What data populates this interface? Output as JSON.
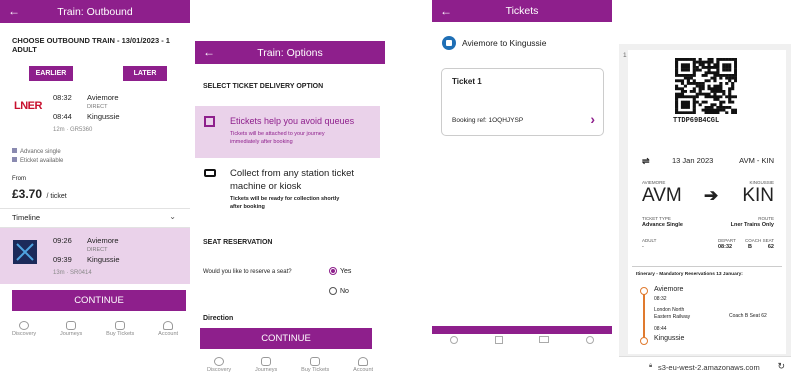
{
  "colors": {
    "brand": "#8e1f8c",
    "highlight": "#ead2ea",
    "lner": "#c8102e",
    "orange": "#e07a2e"
  },
  "outbound": {
    "header_title": "Train: Outbound",
    "heading_line1": "CHOOSE OUTBOUND TRAIN - 13/01/2023 - 1",
    "heading_line2": "ADULT",
    "earlier": "EARLIER",
    "later": "LATER",
    "operator": "LNER",
    "train1": {
      "dep_time": "08:32",
      "dep_station": "Aviemore",
      "type": "DIRECT",
      "arr_time": "08:44",
      "arr_station": "Kingussie",
      "meta": "12m · GR5360"
    },
    "ticket_type": "Advance single",
    "eticket": "Eticket available",
    "from_label": "From",
    "price": "£3.70",
    "price_unit": "/ ticket",
    "timeline": "Timeline",
    "train2": {
      "dep_time": "09:26",
      "dep_station": "Aviemore",
      "type": "DIRECT",
      "arr_time": "09:39",
      "arr_station": "Kingussie",
      "meta": "13m · SR0414"
    },
    "continue": "CONTINUE",
    "nav": [
      "Discovery",
      "Journeys",
      "Buy Tickets",
      "Account"
    ]
  },
  "options": {
    "header_title": "Train: Options",
    "delivery_heading": "SELECT TICKET DELIVERY OPTION",
    "opt1_title": "Etickets help you avoid queues",
    "opt1_desc_1": "Tickets will be attached to your journey",
    "opt1_desc_2": "immediately after booking",
    "opt2_title_1": "Collect from any station ticket",
    "opt2_title_2": "machine or kiosk",
    "opt2_desc_1": "Tickets will be ready for collection shortly",
    "opt2_desc_2": "after booking",
    "seat_heading": "SEAT RESERVATION",
    "seat_question": "Would you like to reserve a seat?",
    "yes": "Yes",
    "no": "No",
    "direction": "Direction",
    "continue": "CONTINUE",
    "nav": [
      "Discovery",
      "Journeys",
      "Buy Tickets",
      "Account"
    ]
  },
  "tickets": {
    "header_title": "Tickets",
    "route": "Aviemore to Kingussie",
    "ticket_label": "Ticket 1",
    "booking_ref": "Booking ref: 1OQHJYSP"
  },
  "eticket": {
    "pager": "1 of 1",
    "code": "TTDP69B4CGL",
    "date": "13 Jan 2023",
    "route_code": "AVM - KIN",
    "from_small": "AVIEMORE",
    "from_code": "AVM",
    "to_small": "KINGUSSIE",
    "to_code": "KIN",
    "ticket_type_label": "TICKET TYPE",
    "ticket_type": "Advance Single",
    "route_label": "ROUTE",
    "route_value": "Lner Trains Only",
    "adult_label": "ADULT",
    "adult_value": "-",
    "depart_label": "DEPART",
    "depart_value": "08:32",
    "coach_label": "COACH",
    "coach_value": "B",
    "seat_label": "SEAT",
    "seat_value": "62",
    "itinerary": "Itinerary - Mandatory Reservations 13 January:",
    "stop1": "Aviemore",
    "stop1_time": "08:32",
    "operator_1": "London North",
    "operator_2": "Eastern Railway",
    "coach_seat": "Coach B Seat 62",
    "arr_time": "08:44",
    "stop2": "Kingussie",
    "url": "s3-eu-west-2.amazonaws.com"
  }
}
